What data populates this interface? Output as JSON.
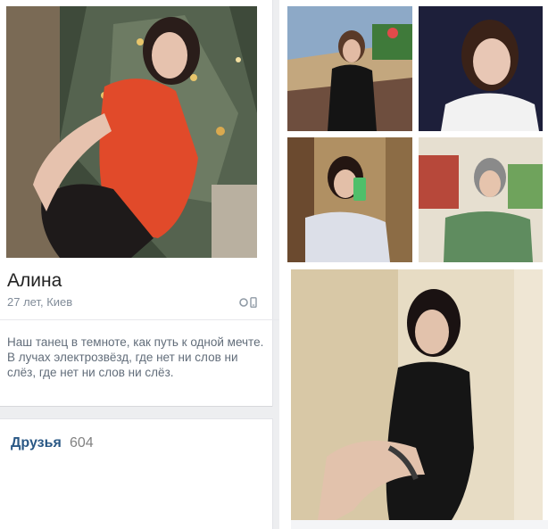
{
  "profile": {
    "name": "Алина",
    "meta": "27 лет, Киев",
    "status": "Наш танец в темноте, как путь к одной мечте. В лучах электрозвёзд, где нет ни слов ни слёз, где нет ни слов ни слёз."
  },
  "friends": {
    "label": "Друзья",
    "count": "604"
  },
  "icons": {
    "online": "online-mobile-icon"
  },
  "colors": {
    "link": "#2a5885",
    "muted": "#818c99",
    "background": "#edeef0"
  }
}
